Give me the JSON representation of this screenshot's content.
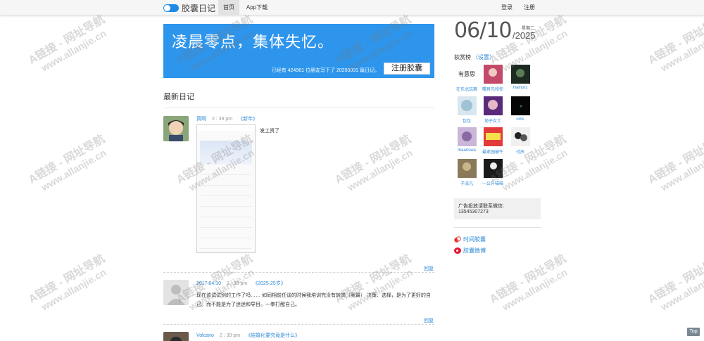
{
  "nav": {
    "brand": "胶囊日记",
    "home": "首页",
    "app": "App下载",
    "login": "登录",
    "register": "注册"
  },
  "banner": {
    "title": "凌晨零点，集体失忆。",
    "info": "已经有 424961 位朋友写下了 20203031 篇日记。",
    "button": "注册胶囊",
    "color": "#2d95ec"
  },
  "section_title": "最新日记",
  "posts": [
    {
      "author": "真啊",
      "time": "2 : 39 pm",
      "tag": "《新年》",
      "text": "发工资了",
      "reply": "回复"
    },
    {
      "author": "2017.04.10",
      "time": "2 : 39 pm",
      "tag": "《2025-25岁》",
      "text": "现在该试试别的工作了吗…… 如同相前任谈的时候我培训完没有转岗（我最）  决策、选择，是为了更好的自己。而不能是为了迷迷和导目。一拳打醒自己。",
      "reply": "回复"
    },
    {
      "author": "Volcano",
      "time": "2 : 39 pm",
      "tag": "《結婚化要究竟是什么》"
    }
  ],
  "date": {
    "day": "06/10",
    "year": "/2025",
    "week": "星期二"
  },
  "ranking": {
    "title": "荻赏榜",
    "settings": "（设置）",
    "items": [
      {
        "name": "在东北玩窝",
        "label": "有意思"
      },
      {
        "name": "曙貝先和你"
      },
      {
        "name": "Halhorz"
      },
      {
        "name": "包包"
      },
      {
        "name": "地子女士"
      },
      {
        "name": "oms"
      },
      {
        "name": "Ihaanswa"
      },
      {
        "name": "最家园被牛"
      },
      {
        "name": "讨厌"
      },
      {
        "name": "子派凡"
      },
      {
        "name": "一公斤喵喵"
      }
    ]
  },
  "ad": {
    "line1": "广告投放请联系微信:",
    "line2": "13545307273"
  },
  "links": {
    "capsule": "时间胶囊",
    "weibo": "胶囊微博"
  },
  "top": "Top",
  "watermark": {
    "line1": "A链接 - 网址导航",
    "line2": "www.allanjie.cn"
  },
  "icons": [
    "toggle-icon",
    "pill-icon",
    "weibo-icon"
  ]
}
